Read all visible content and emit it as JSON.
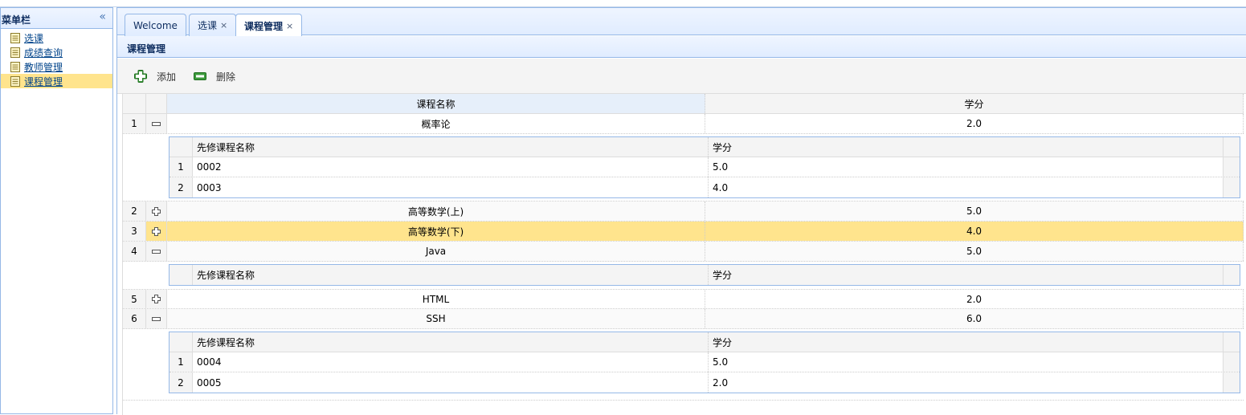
{
  "sidebar": {
    "title": "菜单栏",
    "collapse_icon": "double-chevron-left-icon",
    "items": [
      {
        "label": "选课",
        "icon": "document-icon"
      },
      {
        "label": "成绩查询",
        "icon": "document-icon"
      },
      {
        "label": "教师管理",
        "icon": "document-icon"
      },
      {
        "label": "课程管理",
        "icon": "document-icon",
        "active": true
      }
    ]
  },
  "tabs": [
    {
      "label": "Welcome",
      "closable": false
    },
    {
      "label": "选课",
      "closable": true
    },
    {
      "label": "课程管理",
      "closable": true,
      "active": true
    }
  ],
  "tab_close_glyph": "×",
  "panel": {
    "title": "课程管理"
  },
  "toolbar": {
    "add_label": "添加",
    "add_icon": "add-icon",
    "delete_label": "删除",
    "delete_icon": "remove-icon"
  },
  "grid": {
    "columns": [
      "课程名称",
      "学分"
    ],
    "detail_columns": [
      "先修课程名称",
      "学分"
    ],
    "rows": [
      {
        "num": "1",
        "name": "概率论",
        "credit": "2.0",
        "expanded": true,
        "prereqs": [
          {
            "num": "1",
            "name": "0002",
            "credit": "5.0"
          },
          {
            "num": "2",
            "name": "0003",
            "credit": "4.0"
          }
        ]
      },
      {
        "num": "2",
        "name": "高等数学(上)",
        "credit": "5.0",
        "expanded": false
      },
      {
        "num": "3",
        "name": "高等数学(下)",
        "credit": "4.0",
        "expanded": false,
        "selected": true
      },
      {
        "num": "4",
        "name": "Java",
        "credit": "5.0",
        "expanded": true,
        "prereqs": []
      },
      {
        "num": "5",
        "name": "HTML",
        "credit": "2.0",
        "expanded": false
      },
      {
        "num": "6",
        "name": "SSH",
        "credit": "6.0",
        "expanded": true,
        "prereqs": [
          {
            "num": "1",
            "name": "0004",
            "credit": "5.0"
          },
          {
            "num": "2",
            "name": "0005",
            "credit": "2.0"
          }
        ]
      }
    ]
  },
  "colors": {
    "accent_border": "#95b8e7",
    "selected": "#ffe48d",
    "header_bg": "#e0ecff"
  }
}
